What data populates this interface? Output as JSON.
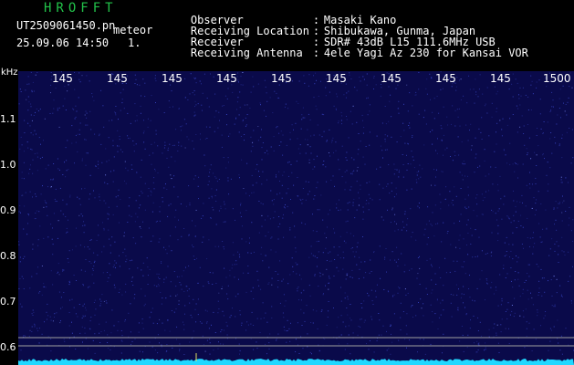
{
  "app": {
    "title": "HROFFT",
    "file_name": "UT2509061450.pn",
    "mode": "meteor",
    "date_time": "25.09.06 14:50",
    "index": "1."
  },
  "metadata": [
    {
      "key": "Observer",
      "value": "Masaki Kano"
    },
    {
      "key": "Receiving Location",
      "value": "Shibukawa, Gunma, Japan"
    },
    {
      "key": "Receiver",
      "value": "SDR# 43dB L15 111.6MHz USB"
    },
    {
      "key": "Receiving Antenna",
      "value": "4ele Yagi Az 230 for Kansai VOR"
    }
  ],
  "spectrogram": {
    "frequency_unit": "kHz",
    "frequency_ticks": [
      "1.1",
      "1.0",
      "0.9",
      "0.8",
      "0.7",
      "0.6"
    ],
    "time_ticks": [
      "145",
      "145",
      "145",
      "145",
      "145",
      "145",
      "145",
      "145",
      "145",
      "1500"
    ],
    "colors": {
      "background": "#0a0a4a",
      "noise_dots": "#3a48c8",
      "signal_trace": "#20d8ff",
      "reference_lines": "#a0a0a0"
    }
  }
}
